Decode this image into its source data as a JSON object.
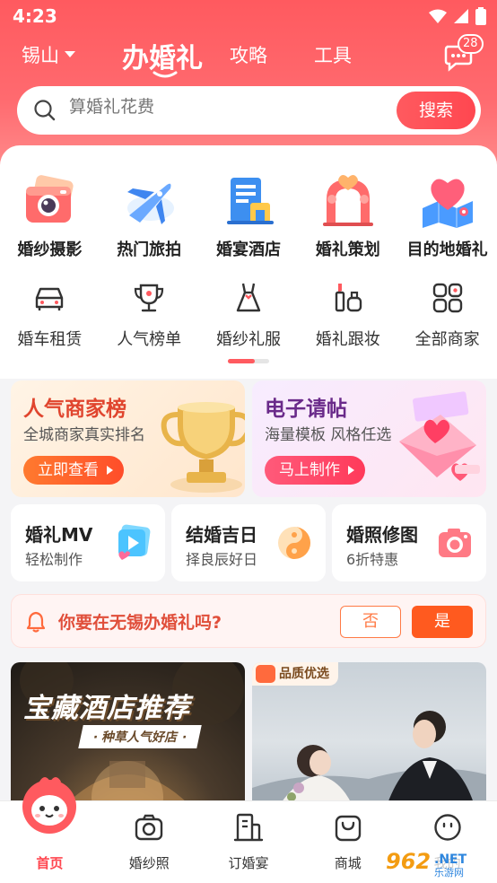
{
  "status_bar": {
    "time": "4:23"
  },
  "topnav": {
    "city": "锡山",
    "tabs": [
      "办婚礼",
      "攻略",
      "工具"
    ],
    "message_badge": "28"
  },
  "search": {
    "placeholder": "算婚礼花费",
    "button": "搜索"
  },
  "categories_primary": [
    {
      "label": "婚纱摄影",
      "icon": "camera-icon"
    },
    {
      "label": "热门旅拍",
      "icon": "airplane-icon"
    },
    {
      "label": "婚宴酒店",
      "icon": "hotel-icon"
    },
    {
      "label": "婚礼策划",
      "icon": "wedding-arch-icon"
    },
    {
      "label": "目的地婚礼",
      "icon": "heart-map-icon"
    }
  ],
  "categories_secondary": [
    {
      "label": "婚车租赁",
      "icon": "car-icon"
    },
    {
      "label": "人气榜单",
      "icon": "trophy-icon"
    },
    {
      "label": "婚纱礼服",
      "icon": "dress-icon"
    },
    {
      "label": "婚礼跟妆",
      "icon": "makeup-icon"
    },
    {
      "label": "全部商家",
      "icon": "grid-icon"
    }
  ],
  "promos": [
    {
      "title": "人气商家榜",
      "subtitle": "全城商家真实排名",
      "button": "立即查看",
      "icon": "gold-trophy-icon"
    },
    {
      "title": "电子请帖",
      "subtitle": "海量模板 风格任选",
      "button": "马上制作",
      "icon": "love-envelope-icon"
    }
  ],
  "tools": [
    {
      "title": "婚礼MV",
      "subtitle": "轻松制作",
      "icon": "video-play-icon"
    },
    {
      "title": "结婚吉日",
      "subtitle": "择良辰好日",
      "icon": "yin-yang-icon"
    },
    {
      "title": "婚照修图",
      "subtitle": "6折特惠",
      "icon": "photo-camera-icon"
    }
  ],
  "prompt": {
    "question": "你要在无锡办婚礼吗?",
    "no": "否",
    "yes": "是"
  },
  "feed": [
    {
      "title": "宝藏酒店推荐",
      "tag": "· 种草人气好店 ·"
    },
    {
      "tag": "品质优选"
    }
  ],
  "bottom_nav": [
    {
      "label": "首页",
      "icon": "home-mascot-icon"
    },
    {
      "label": "婚纱照",
      "icon": "camera-outline-icon"
    },
    {
      "label": "订婚宴",
      "icon": "building-icon"
    },
    {
      "label": "商城",
      "icon": "bag-icon"
    },
    {
      "label": "我的",
      "icon": "smile-icon"
    }
  ],
  "colors": {
    "brand": "#ff5a5f",
    "accent_orange": "#ff5a1f"
  }
}
